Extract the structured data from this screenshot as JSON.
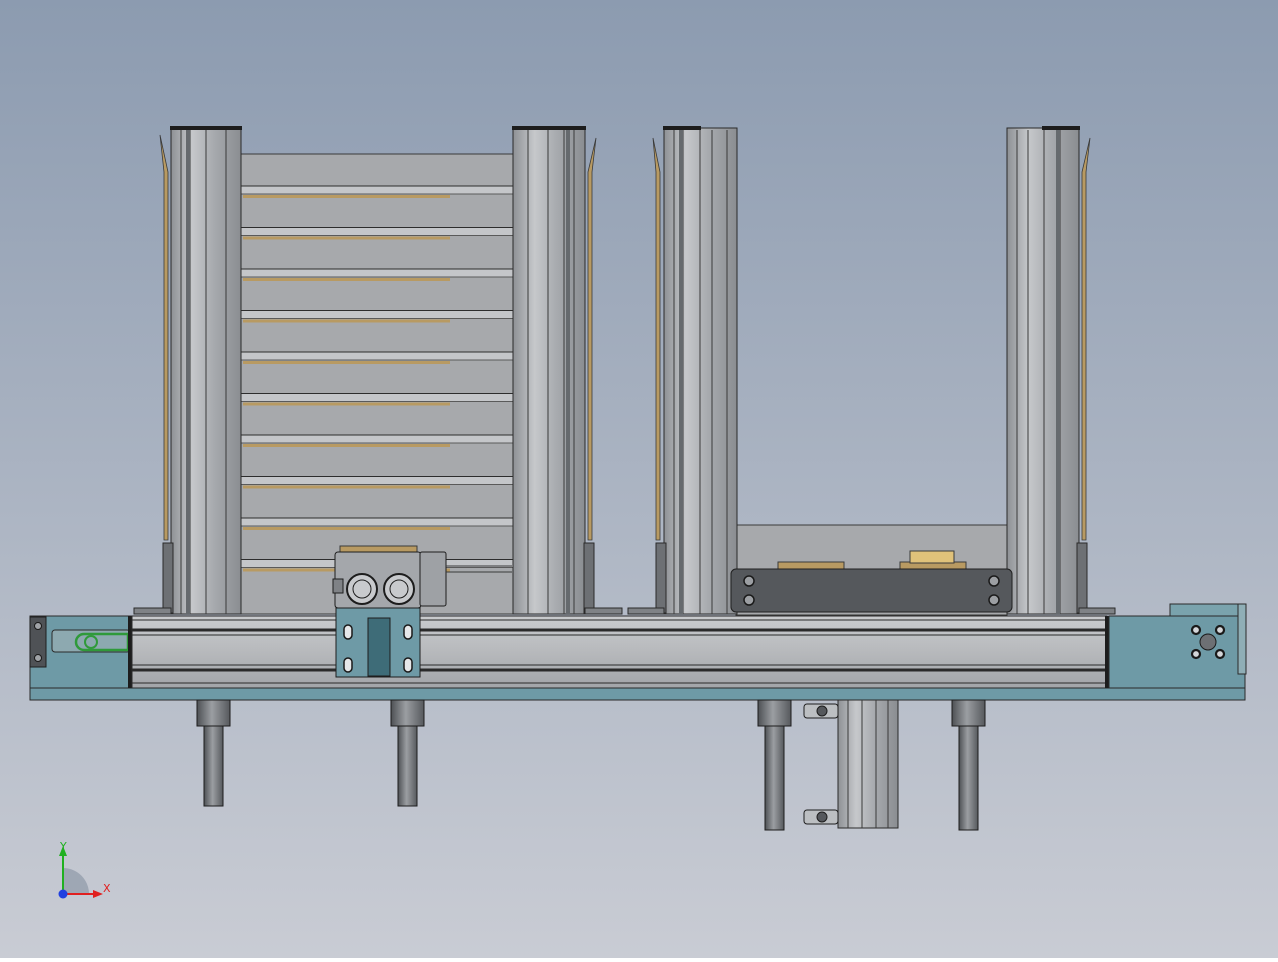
{
  "viewport": {
    "background_top": "#8c9bb0",
    "background_bottom": "#c9ccd4"
  },
  "colors": {
    "aluminum": "#b4b7bb",
    "aluminum_dark": "#7d8084",
    "aluminum_light": "#d0d2d5",
    "slot_dark": "#2a2a2a",
    "panel_gray": "#a9abae",
    "plate_teal": "#6e9aa6",
    "wood": "#b89a62",
    "bracket_dark": "#55585c",
    "green_link": "#2f9a3a",
    "axis_x": "#e02020",
    "axis_y": "#20b020",
    "axis_z": "#2040e0"
  },
  "triad": {
    "x_label": "X",
    "y_label": "Y"
  }
}
